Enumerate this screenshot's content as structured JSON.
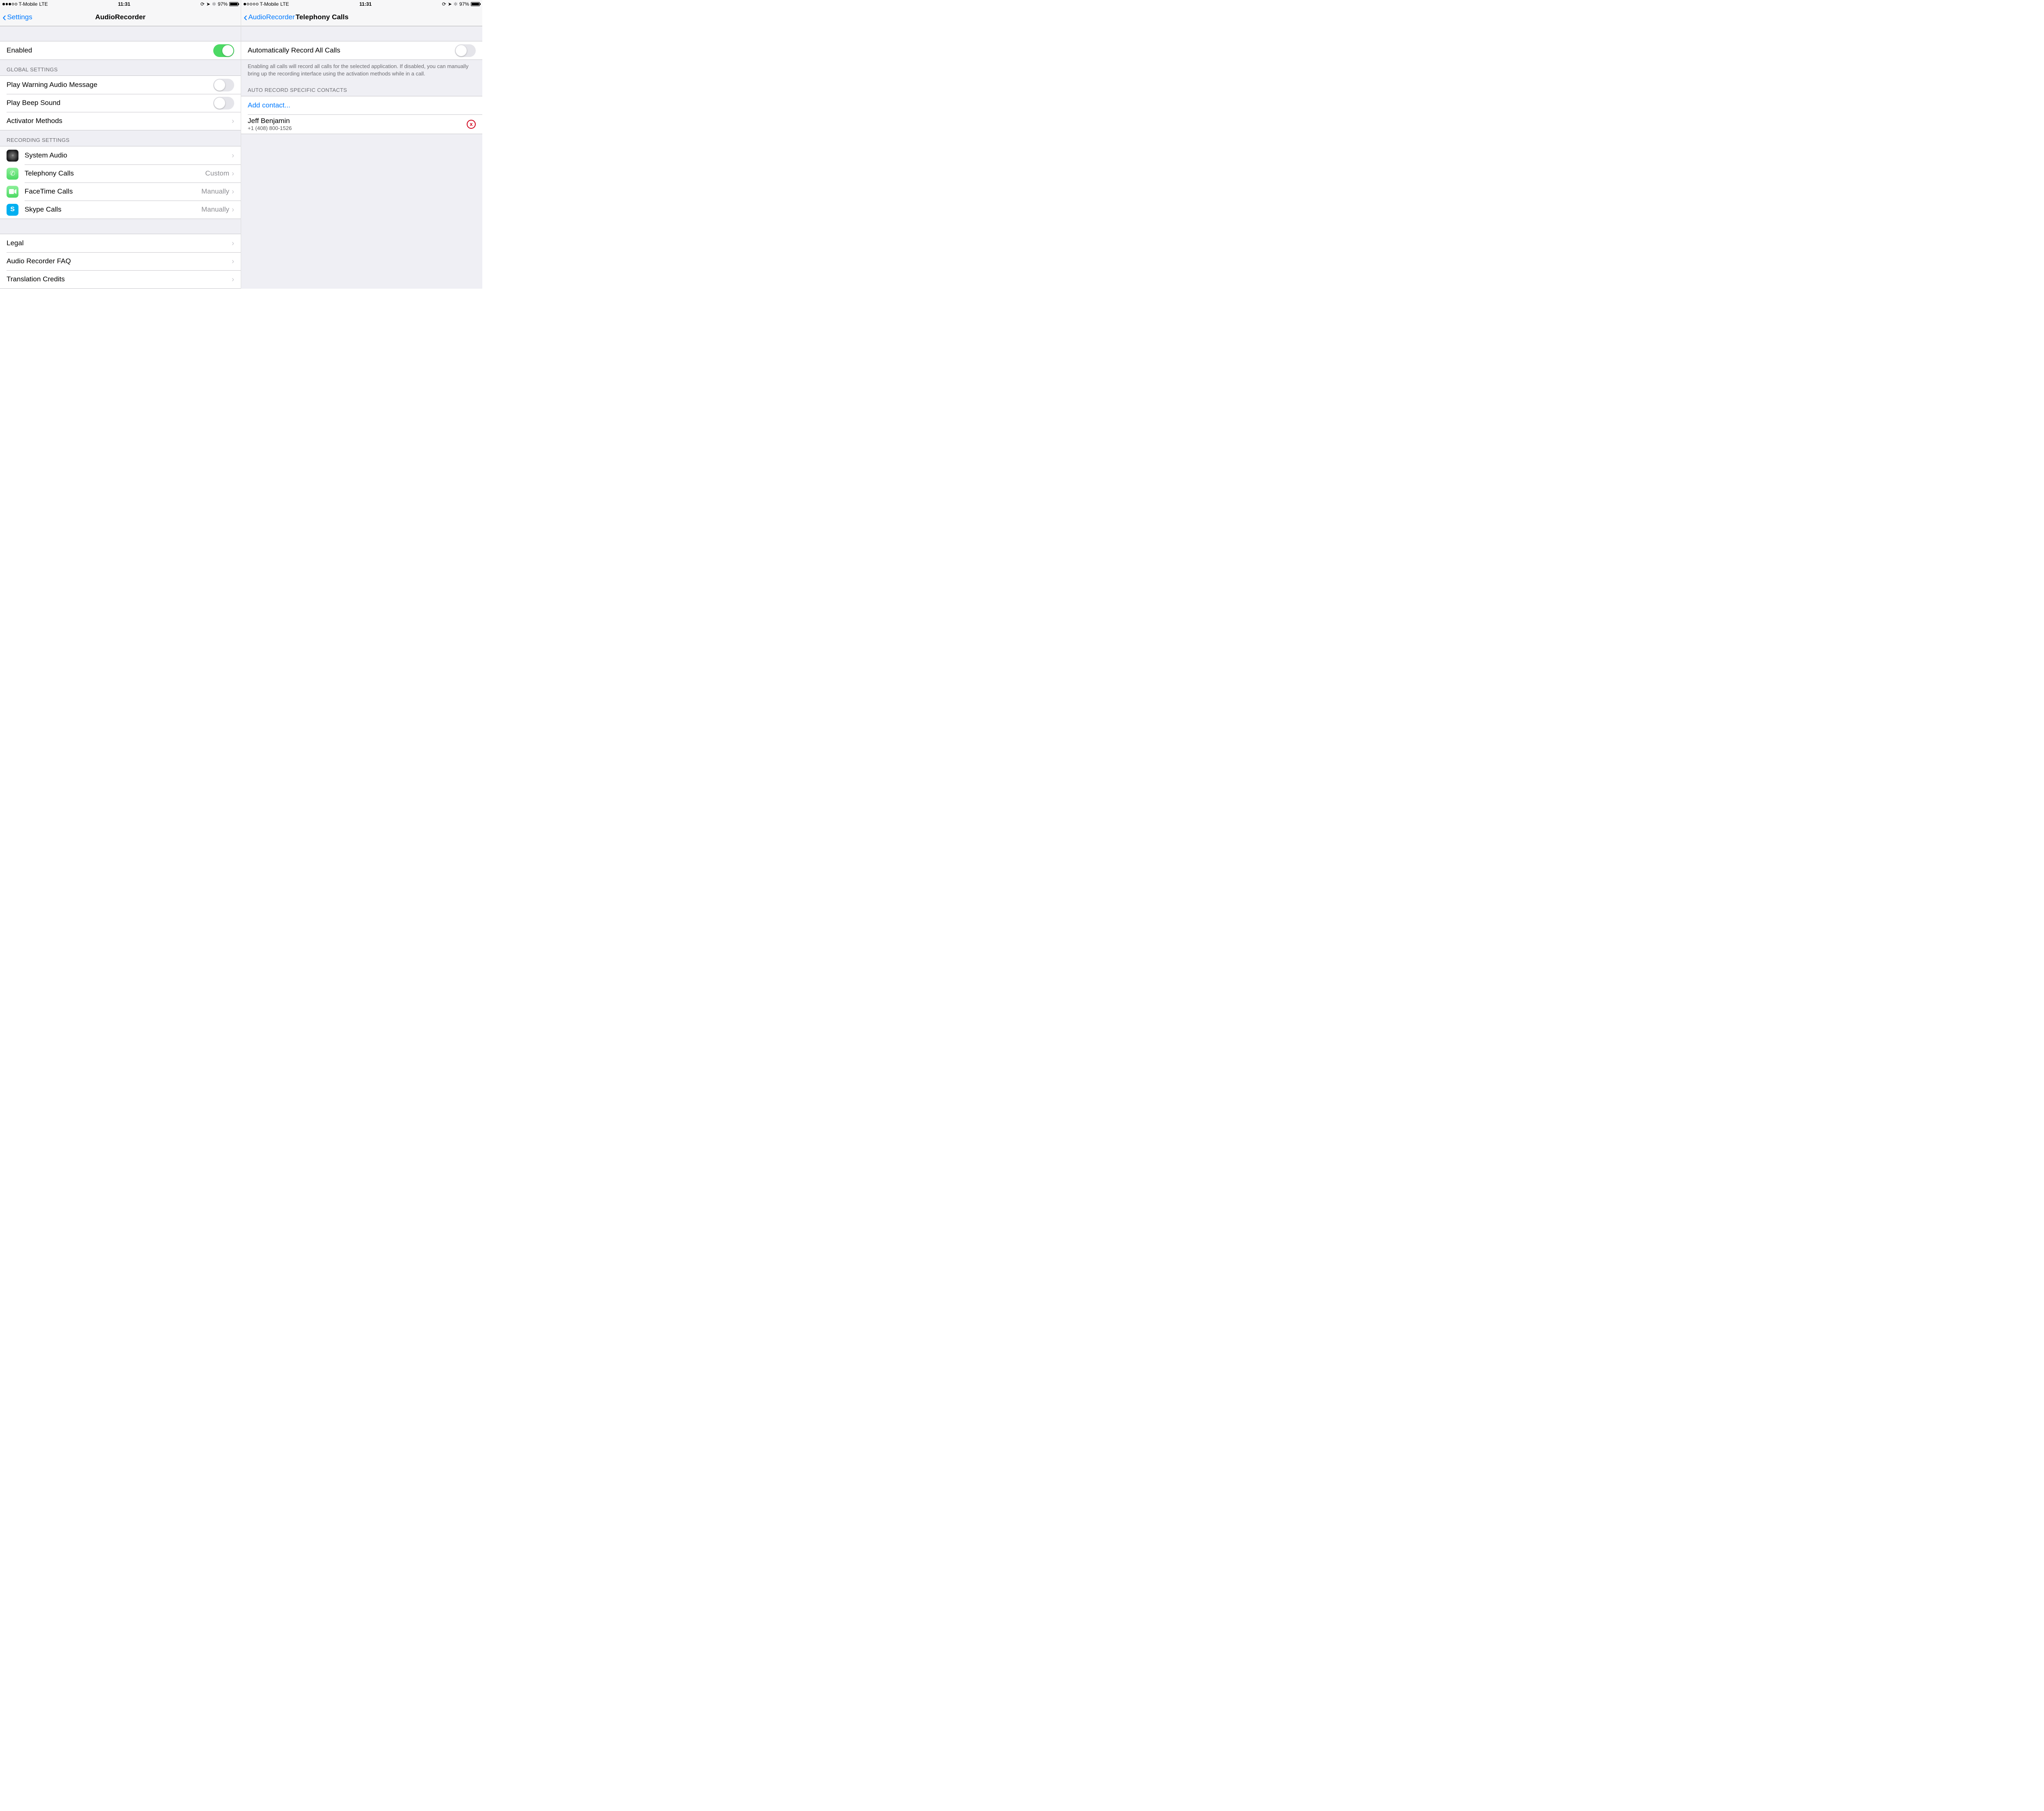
{
  "statusbar": {
    "carrier": "T-Mobile",
    "network": "LTE",
    "time": "11:31",
    "battery_pct": "97%",
    "signal_left_filled": 3,
    "signal_right_filled": 1
  },
  "left": {
    "back_label": "Settings",
    "title": "AudioRecorder",
    "enabled_label": "Enabled",
    "enabled_on": true,
    "global_header": "GLOBAL SETTINGS",
    "rows_global": {
      "warn": {
        "label": "Play Warning Audio Message",
        "on": false
      },
      "beep": {
        "label": "Play Beep Sound",
        "on": false
      },
      "activator": {
        "label": "Activator Methods"
      }
    },
    "recording_header": "RECORDING SETTINGS",
    "rows_recording": {
      "system": {
        "label": "System Audio",
        "detail": ""
      },
      "telephony": {
        "label": "Telephony Calls",
        "detail": "Custom"
      },
      "facetime": {
        "label": "FaceTime Calls",
        "detail": "Manually"
      },
      "skype": {
        "label": "Skype Calls",
        "detail": "Manually"
      }
    },
    "rows_footer": {
      "legal": {
        "label": "Legal"
      },
      "faq": {
        "label": "Audio Recorder FAQ"
      },
      "credits": {
        "label": "Translation Credits"
      }
    }
  },
  "right": {
    "back_label": "AudioRecorder",
    "title": "Telephony Calls",
    "auto_label": "Automatically Record All Calls",
    "auto_on": false,
    "auto_footer": "Enabling all calls will record all calls for the selected application. If disabled, you can manually bring up the recording interface using the activation methods while in a call.",
    "contacts_header": "AUTO RECORD SPECIFIC CONTACTS",
    "add_label": "Add contact...",
    "contact": {
      "name": "Jeff Benjamin",
      "phone": "+1 (408) 800-1526"
    }
  },
  "icons": {
    "system_audio": "speaker-icon",
    "telephony": "phone-icon",
    "facetime": "facetime-icon",
    "skype": "skype-icon"
  },
  "colors": {
    "accent": "#007aff",
    "toggle_on": "#4cd964",
    "delete": "#d0021b",
    "phone_green": "#4cd964",
    "facetime_green": "#4cd964",
    "skype_blue": "#00aff0",
    "speaker_dark": "#1c1c1e"
  }
}
